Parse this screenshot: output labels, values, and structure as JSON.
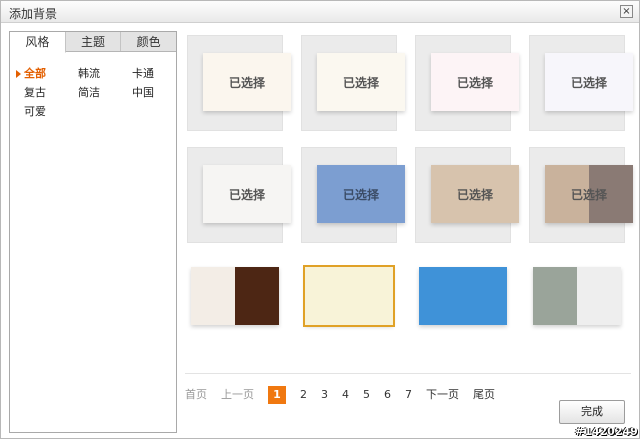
{
  "dialog": {
    "title": "添加背景",
    "close_glyph": "×"
  },
  "tabs": [
    {
      "label": "风格",
      "active": true
    },
    {
      "label": "主题",
      "active": false
    },
    {
      "label": "颜色",
      "active": false
    }
  ],
  "styles": [
    {
      "label": "全部",
      "selected": true
    },
    {
      "label": "韩流"
    },
    {
      "label": "卡通"
    },
    {
      "label": "复古"
    },
    {
      "label": "简洁"
    },
    {
      "label": "中国"
    },
    {
      "label": "可爱"
    }
  ],
  "thumbnails": [
    {
      "label": "已选择",
      "color": "#fbf6ee"
    },
    {
      "label": "已选择",
      "color": "#fbf8f0"
    },
    {
      "label": "已选择",
      "color": "#fdf4f6"
    },
    {
      "label": "已选择",
      "color": "#f7f6fb"
    },
    {
      "label": "已选择",
      "color": "#f6f5f3"
    },
    {
      "label": "已选择",
      "color": "#7c9ed1"
    },
    {
      "label": "已选择",
      "color": "#d7c3ad"
    },
    {
      "label": "已选择",
      "color": "#c9b29c",
      "split_color": "#8a7a74"
    },
    {
      "label": "",
      "color": "#f3ede6",
      "split_color": "#4d2614"
    },
    {
      "label": "",
      "color": "#f8f3d8",
      "selected": true
    },
    {
      "label": "",
      "color": "#3f92d8"
    },
    {
      "label": "",
      "color": "#9aa49a",
      "split_color": "#eeeeee"
    }
  ],
  "pager": {
    "first": "首页",
    "prev": "上一页",
    "pages": [
      "1",
      "2",
      "3",
      "4",
      "5",
      "6",
      "7"
    ],
    "current": "1",
    "next": "下一页",
    "last": "尾页"
  },
  "done_label": "完成",
  "watermark": "#1420249"
}
